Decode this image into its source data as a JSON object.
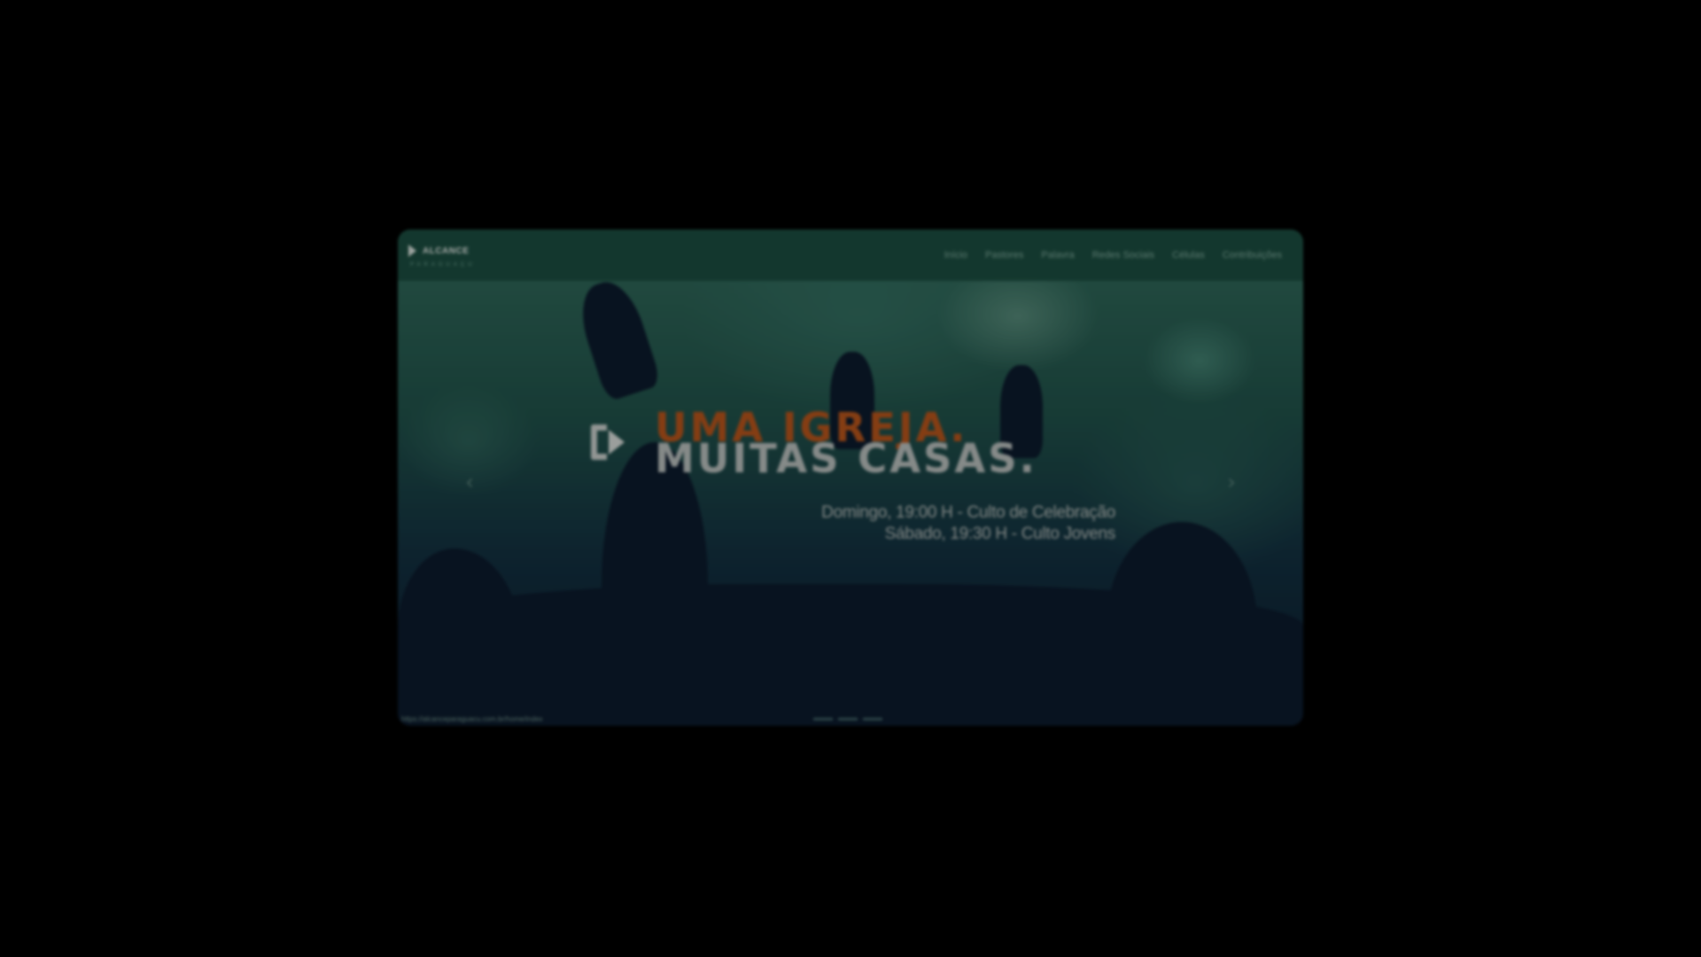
{
  "nav": {
    "brand_name": "ALCANCE",
    "brand_tagline": "PARAGUAÇU",
    "links": [
      {
        "label": "Início"
      },
      {
        "label": "Pastores"
      },
      {
        "label": "Palavra"
      },
      {
        "label": "Redes Sociais"
      },
      {
        "label": "Células"
      },
      {
        "label": "Contribuições"
      }
    ]
  },
  "hero": {
    "headline_line1": "UMA IGREJA.",
    "headline_line2": "MUITAS CASAS.",
    "schedule": [
      "Domingo, 19:00 H - Culto de Celebração",
      "Sábado, 19:30 H - Culto Jovens"
    ],
    "prev_arrow": "‹",
    "next_arrow": "›",
    "slide_count": 3
  },
  "status_url": "https://alcanceparaguacu.com.br/home/index",
  "colors": {
    "navbar": "#1b4d40",
    "headline_accent": "#b8551b",
    "headline_secondary": "#b9bfbd",
    "backdrop": "#000000"
  },
  "icons": {
    "brand": "alcance-logo-icon",
    "hero_logo": "alcance-play-mark-icon",
    "prev": "chevron-left-icon",
    "next": "chevron-right-icon"
  }
}
